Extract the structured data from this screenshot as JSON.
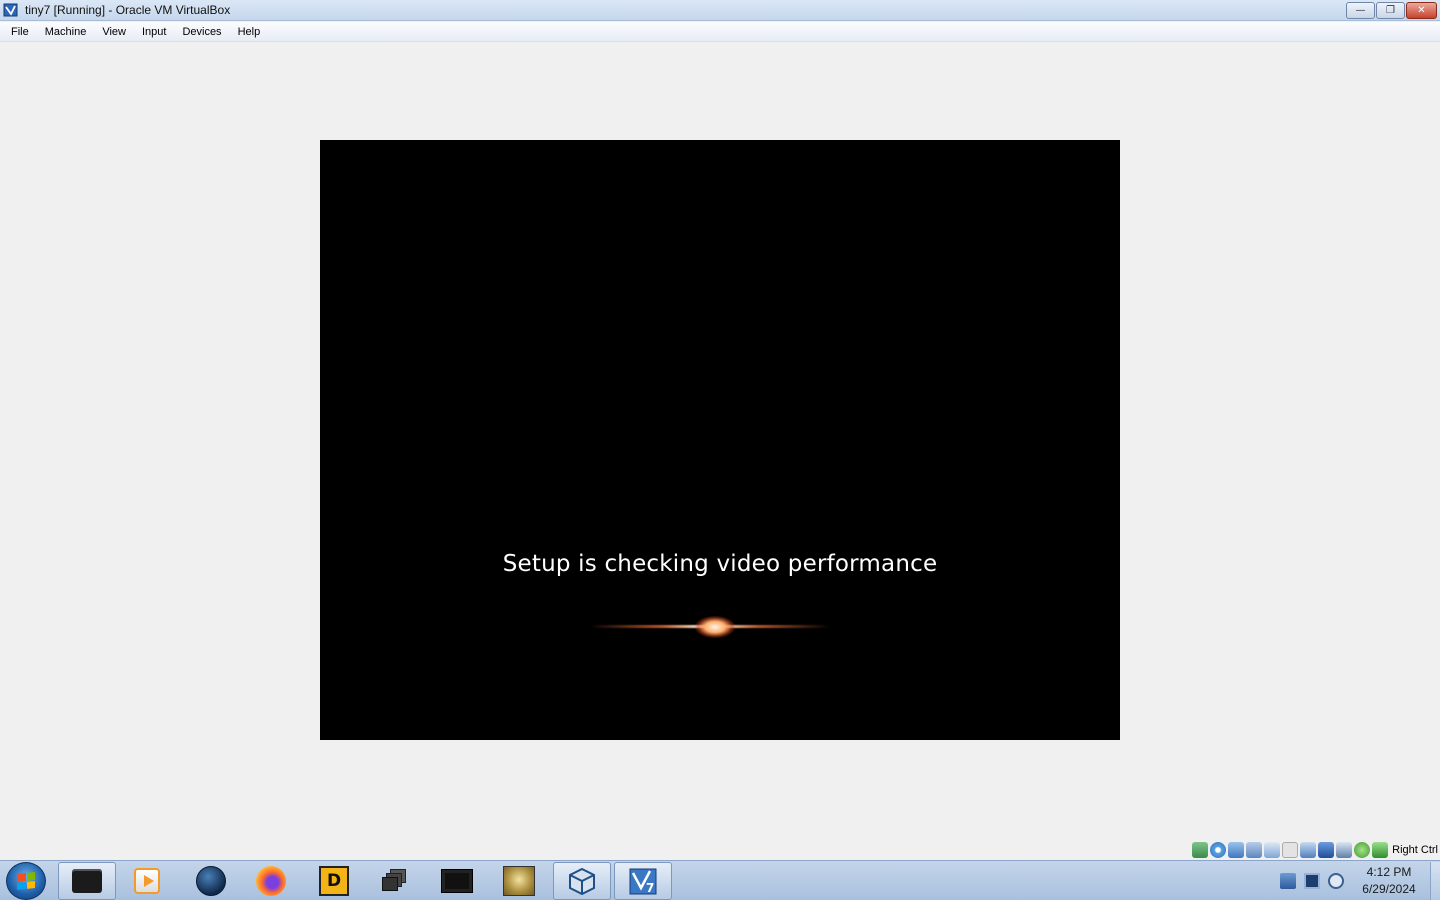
{
  "window": {
    "title": "tiny7 [Running] - Oracle VM VirtualBox",
    "controls": {
      "minimize": "—",
      "restore": "❐",
      "close": "✕"
    }
  },
  "menu": {
    "items": [
      "File",
      "Machine",
      "View",
      "Input",
      "Devices",
      "Help"
    ]
  },
  "vm": {
    "message": "Setup is checking video performance"
  },
  "status_bar": {
    "icons": [
      "hard-disk-icon",
      "optical-drive-icon",
      "audio-icon",
      "network-icon",
      "usb-icon",
      "shared-folders-icon",
      "display-icon",
      "recording-icon",
      "virtualization-icon",
      "mouse-integration-icon",
      "keyboard-icon"
    ],
    "host_key": "Right Ctrl"
  },
  "taskbar": {
    "apps": [
      "terminal-app-icon",
      "media-player-icon",
      "globe-browser-icon",
      "firefox-icon",
      "de-app-icon",
      "windows-stack-icon",
      "console-icon",
      "vbox-cat-icon",
      "virtualbox-icon",
      "windows7-vm-icon"
    ],
    "clock_time": "4:12 PM",
    "clock_date": "6/29/2024"
  }
}
